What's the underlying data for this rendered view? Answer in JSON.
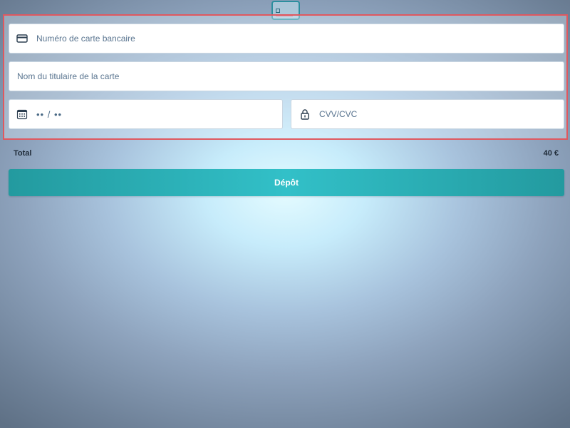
{
  "header": {
    "icon": "credit-card-icon"
  },
  "form": {
    "card_number": {
      "icon": "credit-card-icon",
      "placeholder": "Numéro de carte bancaire",
      "value": ""
    },
    "cardholder_name": {
      "placeholder": "Nom du titulaire de la carte",
      "value": ""
    },
    "expiry": {
      "icon": "calendar-icon",
      "display": "•• / ••"
    },
    "cvv": {
      "icon": "lock-icon",
      "placeholder": "CVV/CVC",
      "value": ""
    }
  },
  "summary": {
    "total_label": "Total",
    "total_value": "40 €"
  },
  "actions": {
    "deposit_label": "Dépôt"
  },
  "colors": {
    "accent": "#32c0c8",
    "highlight_border": "#e0585f",
    "text_label": "#1f2b38",
    "placeholder": "#5a7590"
  }
}
